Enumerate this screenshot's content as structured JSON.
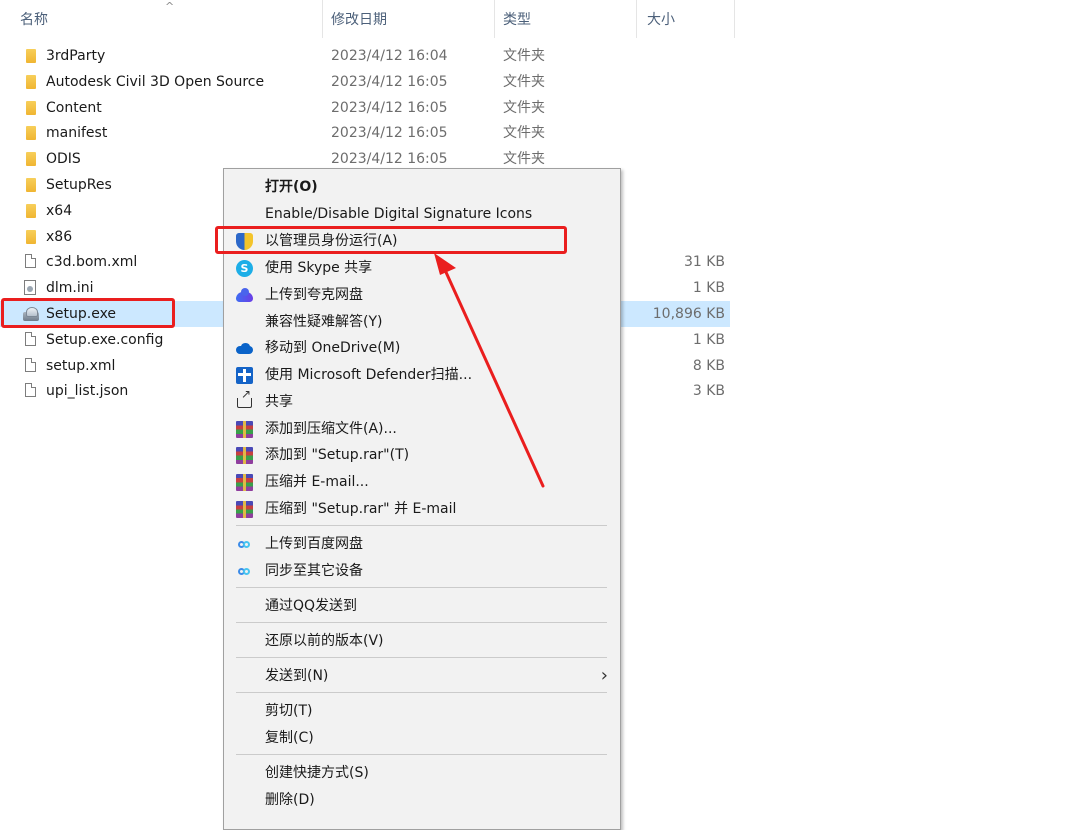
{
  "columns": {
    "name": "名称",
    "date": "修改日期",
    "type": "类型",
    "size": "大小"
  },
  "files": [
    {
      "name": "3rdParty",
      "date": "2023/4/12 16:04",
      "type": "文件夹",
      "size": "",
      "icon": "folder-icon"
    },
    {
      "name": "Autodesk Civil 3D Open Source",
      "date": "2023/4/12 16:05",
      "type": "文件夹",
      "size": "",
      "icon": "folder-icon"
    },
    {
      "name": "Content",
      "date": "2023/4/12 16:05",
      "type": "文件夹",
      "size": "",
      "icon": "folder-icon"
    },
    {
      "name": "manifest",
      "date": "2023/4/12 16:05",
      "type": "文件夹",
      "size": "",
      "icon": "folder-icon"
    },
    {
      "name": "ODIS",
      "date": "2023/4/12 16:05",
      "type": "文件夹",
      "size": "",
      "icon": "folder-icon"
    },
    {
      "name": "SetupRes",
      "date": "",
      "type": "",
      "size": "",
      "icon": "folder-icon"
    },
    {
      "name": "x64",
      "date": "",
      "type": "",
      "size": "",
      "icon": "folder-icon"
    },
    {
      "name": "x86",
      "date": "",
      "type": "",
      "size": "",
      "icon": "folder-icon"
    },
    {
      "name": "c3d.bom.xml",
      "date": "",
      "type": "",
      "size": "31 KB",
      "icon": "document-icon"
    },
    {
      "name": "dlm.ini",
      "date": "",
      "type": "",
      "size": "1 KB",
      "icon": "ini-file-icon"
    },
    {
      "name": "Setup.exe",
      "date": "",
      "type": "",
      "size": "10,896 KB",
      "icon": "setup-exe-icon"
    },
    {
      "name": "Setup.exe.config",
      "date": "",
      "type": "",
      "size": "1 KB",
      "icon": "document-icon"
    },
    {
      "name": "setup.xml",
      "date": "",
      "type": "",
      "size": "8 KB",
      "icon": "document-icon"
    },
    {
      "name": "upi_list.json",
      "date": "",
      "type": "",
      "size": "3 KB",
      "icon": "document-icon"
    }
  ],
  "selected_file": "Setup.exe",
  "context_menu": {
    "items": [
      {
        "label": "打开(O)",
        "icon": "",
        "bold": true
      },
      {
        "label": "Enable/Disable Digital Signature Icons",
        "icon": ""
      },
      {
        "label": "以管理员身份运行(A)",
        "icon": "uac-shield-icon"
      },
      {
        "label": "使用 Skype 共享",
        "icon": "skype-icon"
      },
      {
        "label": "上传到夸克网盘",
        "icon": "quark-cloud-icon"
      },
      {
        "label": "兼容性疑难解答(Y)",
        "icon": ""
      },
      {
        "label": "移动到 OneDrive(M)",
        "icon": "onedrive-icon"
      },
      {
        "label": "使用 Microsoft Defender扫描...",
        "icon": "defender-icon"
      },
      {
        "label": "共享",
        "icon": "share-icon"
      },
      {
        "label": "添加到压缩文件(A)...",
        "icon": "winrar-icon"
      },
      {
        "label": "添加到 \"Setup.rar\"(T)",
        "icon": "winrar-icon"
      },
      {
        "label": "压缩并 E-mail...",
        "icon": "winrar-icon"
      },
      {
        "label": "压缩到 \"Setup.rar\" 并 E-mail",
        "icon": "winrar-icon"
      },
      {
        "label": "上传到百度网盘",
        "icon": "baidu-netdisk-icon"
      },
      {
        "label": "同步至其它设备",
        "icon": "baidu-netdisk-icon"
      },
      {
        "label": "通过QQ发送到",
        "icon": ""
      },
      {
        "label": "还原以前的版本(V)",
        "icon": ""
      },
      {
        "label": "发送到(N)",
        "icon": "",
        "submenu": true
      },
      {
        "label": "剪切(T)",
        "icon": ""
      },
      {
        "label": "复制(C)",
        "icon": ""
      },
      {
        "label": "创建快捷方式(S)",
        "icon": ""
      },
      {
        "label": "删除(D)",
        "icon": ""
      }
    ]
  },
  "colors": {
    "selection": "#cce8ff",
    "annotation": "#ea1e1e",
    "menu_bg": "#f2f2f2"
  }
}
